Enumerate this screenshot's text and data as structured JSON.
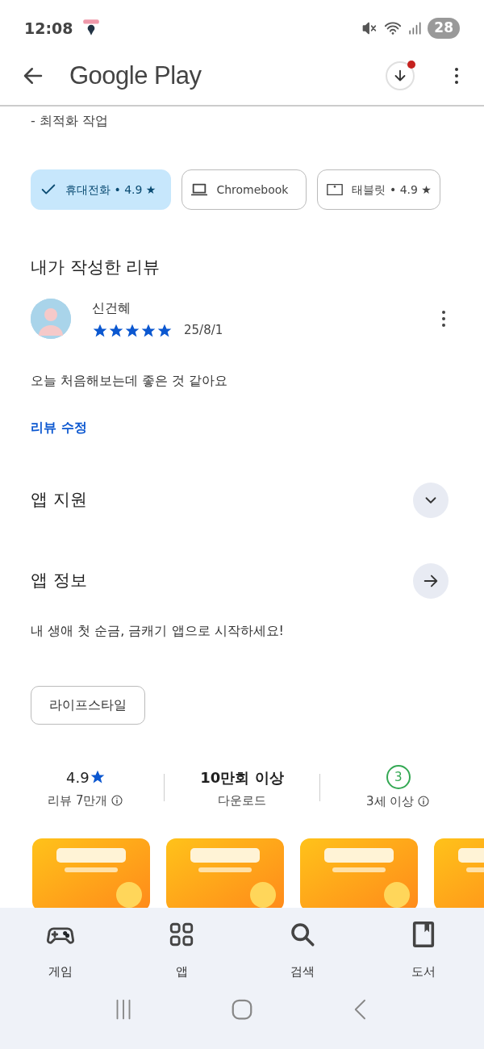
{
  "status_bar": {
    "time": "12:08",
    "battery": "28"
  },
  "app_bar": {
    "title": "Google Play",
    "download_badge": true
  },
  "top_text": "- 최적화 작업",
  "device_chips": [
    {
      "label": "휴대전화 • 4.9 ★",
      "selected": true
    },
    {
      "label": "Chromebook",
      "kind": "laptop",
      "selected": false
    },
    {
      "label": "태블릿 • 4.9 ★",
      "kind": "tablet",
      "selected": false
    }
  ],
  "my_review": {
    "heading": "내가 작성한 리뷰",
    "author": "신건혜",
    "stars": 5,
    "date": "25/8/1",
    "text": "오늘 처음해보는데 좋은 것 같아요",
    "edit_link": "리뷰 수정"
  },
  "sections": [
    {
      "title": "앱 지원",
      "kind": "expand"
    },
    {
      "title": "앱 정보",
      "kind": "arrow"
    }
  ],
  "app_description": "내 생애 첫 순금, 금캐기 앱으로 시작하세요!",
  "category": "라이프스타일",
  "stats": [
    {
      "kind": "rating",
      "value": "4.9",
      "label": "리뷰 7만개",
      "info": true
    },
    {
      "kind": "text",
      "value": "10만회 이상",
      "label": "다운로드",
      "info": false
    },
    {
      "kind": "age",
      "value": "3",
      "label": "3세 이상",
      "info": true
    }
  ],
  "bottom_nav": [
    {
      "label": "게임"
    },
    {
      "label": "앱"
    },
    {
      "label": "검색"
    },
    {
      "label": "도서"
    }
  ]
}
